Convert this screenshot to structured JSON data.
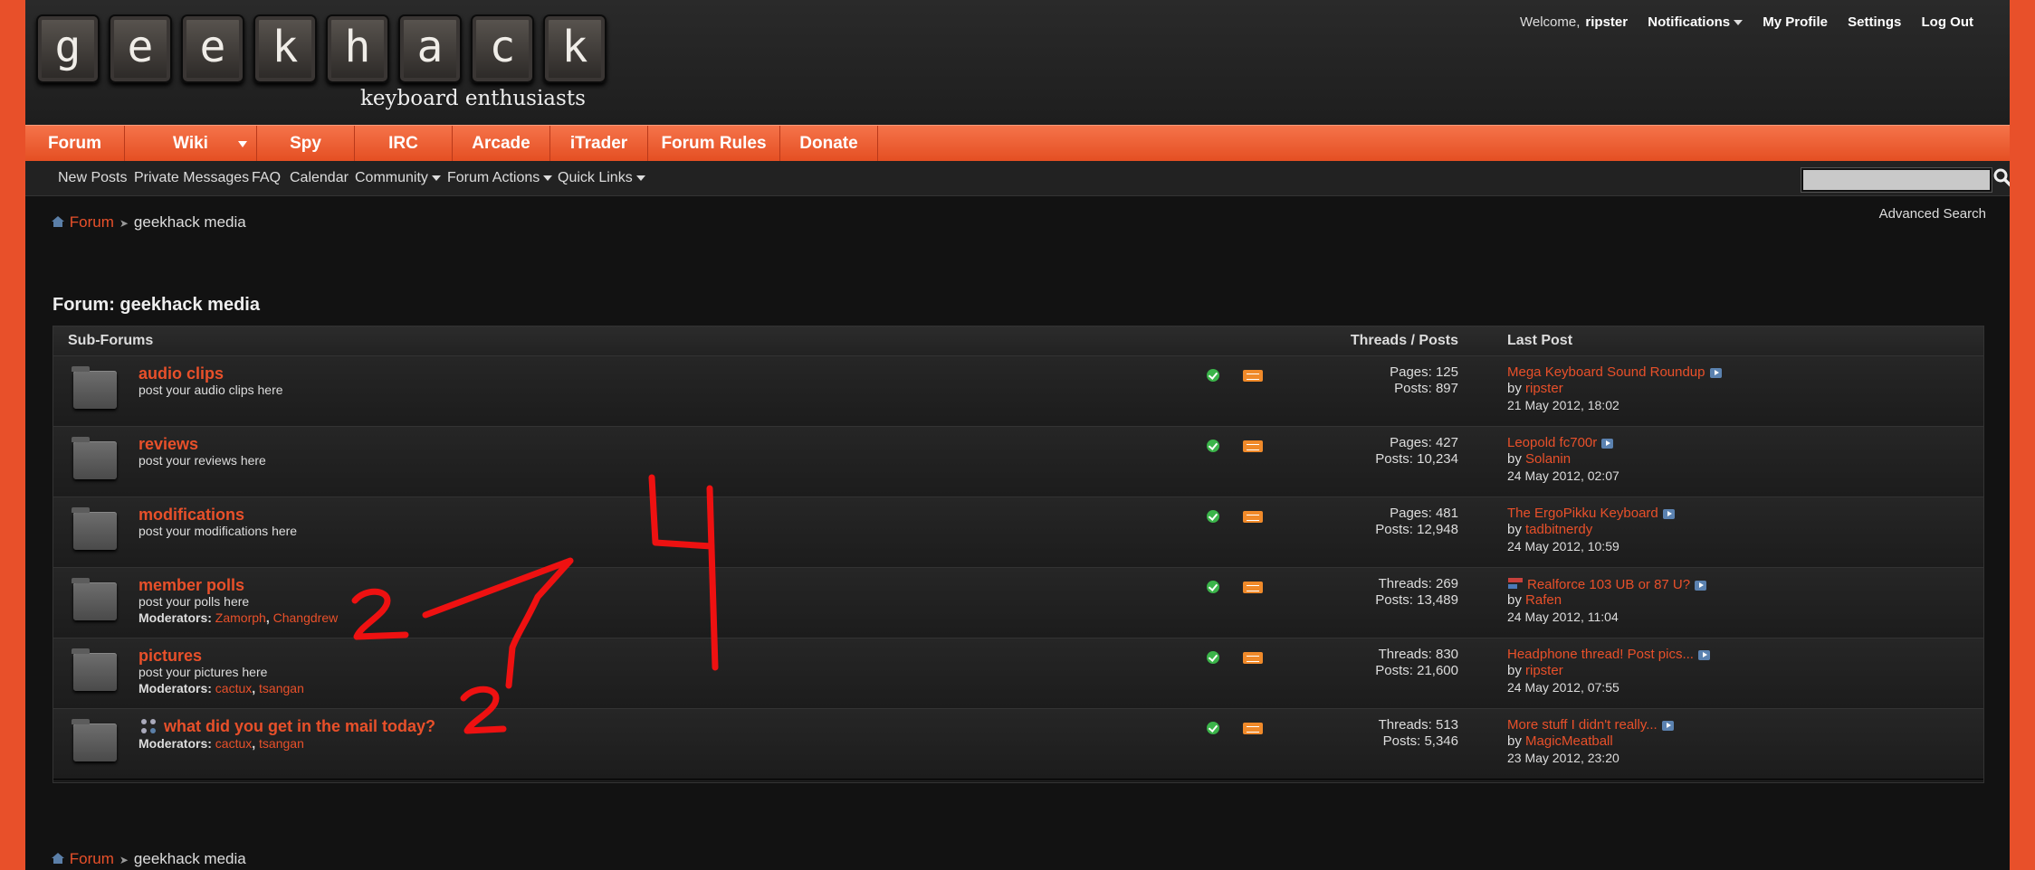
{
  "header": {
    "logo_letters": [
      "g",
      "e",
      "e",
      "k",
      "h",
      "a",
      "c",
      "k"
    ],
    "tagline": "keyboard enthusiasts",
    "userbar": {
      "welcome": "Welcome,",
      "username": "ripster",
      "notifications": "Notifications",
      "profile": "My Profile",
      "settings": "Settings",
      "logout": "Log Out"
    }
  },
  "navbar": {
    "tabs": [
      "Forum",
      "Wiki",
      "Spy",
      "IRC",
      "Arcade",
      "iTrader",
      "Forum Rules",
      "Donate"
    ]
  },
  "subnav": {
    "links": [
      "New Posts",
      "Private Messages",
      "FAQ",
      "Calendar",
      "Community",
      "Forum Actions",
      "Quick Links"
    ],
    "advanced_search": "Advanced Search"
  },
  "breadcrumb": {
    "root": "Forum",
    "current": "geekhack media"
  },
  "forum": {
    "title": "Forum: geekhack media",
    "headers": {
      "subforums": "Sub-Forums",
      "threads_posts": "Threads / Posts",
      "last_post": "Last Post"
    },
    "rows": [
      {
        "title": "audio clips",
        "desc": "post your audio clips here",
        "mods_label": "",
        "mods": [],
        "stat1": "Pages: 125",
        "stat2": "Posts: 897",
        "lp_title": "Mega Keyboard Sound Roundup",
        "lp_by": "by",
        "lp_user": "ripster",
        "lp_date": "21 May 2012,",
        "lp_time": "18:02"
      },
      {
        "title": "reviews",
        "desc": "post your reviews here",
        "mods_label": "",
        "mods": [],
        "stat1": "Pages: 427",
        "stat2": "Posts: 10,234",
        "lp_title": "Leopold fc700r",
        "lp_by": "by",
        "lp_user": "Solanin",
        "lp_date": "24 May 2012,",
        "lp_time": "02:07"
      },
      {
        "title": "modifications",
        "desc": "post your modifications here",
        "mods_label": "",
        "mods": [],
        "stat1": "Pages: 481",
        "stat2": "Posts: 12,948",
        "lp_title": "The ErgoPikku Keyboard",
        "lp_by": "by",
        "lp_user": "tadbitnerdy",
        "lp_date": "24 May 2012,",
        "lp_time": "10:59"
      },
      {
        "title": "member polls",
        "desc": "post your polls here",
        "mods_label": "Moderators:",
        "mods": [
          "Zamorph",
          "Changdrew"
        ],
        "stat1": "Threads: 269",
        "stat2": "Posts: 13,489",
        "lp_title": "Realforce 103 UB or 87 U?",
        "lp_by": "by",
        "lp_user": "Rafen",
        "lp_date": "24 May 2012,",
        "lp_time": "11:04"
      },
      {
        "title": "pictures",
        "desc": "post your pictures here",
        "mods_label": "Moderators:",
        "mods": [
          "cactux",
          "tsangan"
        ],
        "stat1": "Threads: 830",
        "stat2": "Posts: 21,600",
        "lp_title": "Headphone thread! Post pics...",
        "lp_by": "by",
        "lp_user": "ripster",
        "lp_date": "24 May 2012,",
        "lp_time": "07:55"
      },
      {
        "title": "what did you get in the mail today?",
        "desc": "",
        "mods_label": "Moderators:",
        "mods": [
          "cactux",
          "tsangan"
        ],
        "stat1": "Threads: 513",
        "stat2": "Posts: 5,346",
        "lp_title": "More stuff I didn't really...",
        "lp_by": "by",
        "lp_user": "MagicMeatball",
        "lp_date": "23 May 2012,",
        "lp_time": "23:20"
      }
    ]
  },
  "colors": {
    "accent": "#e8502a",
    "page_bg": "#121212",
    "nav_orange": "#f26a3e",
    "annotation": "#ee1111"
  },
  "annotations": [
    "2",
    "2",
    "4"
  ]
}
